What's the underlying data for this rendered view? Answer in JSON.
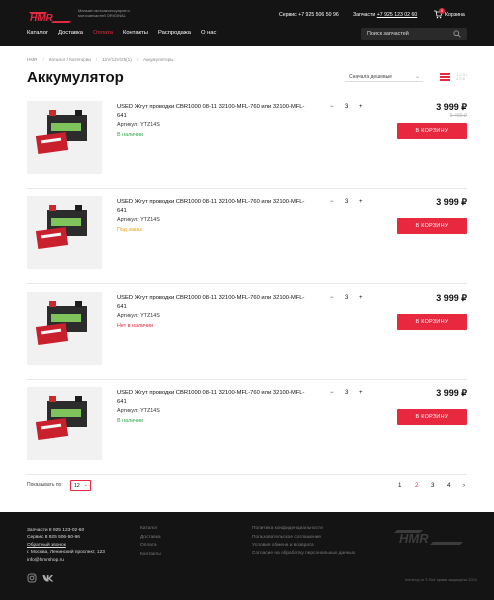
{
  "header": {
    "tagline": "Магазин мотоаксессуаров и мотозапчастей ORIGINAL",
    "service_phone": "Сервис +7 925 506 50 96",
    "parts_label": "Запчасти",
    "parts_phone": "+7 925 123 02 60",
    "cart_label": "Корзина",
    "cart_count": "0",
    "nav": [
      "Каталог",
      "Доставка",
      "Оплата",
      "Контакты",
      "Распродажа",
      "О нас"
    ],
    "search_placeholder": "Поиск запчастей"
  },
  "breadcrumbs": [
    "HMR",
    "Каталог / Категории",
    "12V/12V/25(1)",
    "Аккумуляторы"
  ],
  "page_title": "Аккумулятор",
  "sort_label": "Сначала дешевые",
  "view_grid_label": "1 2 3 / 4 5 6",
  "products": [
    {
      "title": "USED Жгут проводки CBR1000 08-11 32100-MFL-760 или 32100-MFL-641",
      "article": "Артикул: YTZ14S",
      "stock": "В наличии",
      "stock_color": "#2ba84a",
      "qty": "3",
      "price": "3 999 ₽",
      "old_price": "5 490 ₽",
      "buy": "В КОРЗИНУ"
    },
    {
      "title": "USED Жгут проводки CBR1000 08-11 32100-MFL-760 или 32100-MFL-641",
      "article": "Артикул: YTZ14S",
      "stock": "Под заказ",
      "stock_color": "#f0a020",
      "qty": "3",
      "price": "3 999 ₽",
      "old_price": "",
      "buy": "В КОРЗИНУ"
    },
    {
      "title": "USED Жгут проводки CBR1000 08-11 32100-MFL-760 или 32100-MFL-641",
      "article": "Артикул: YTZ14S",
      "stock": "Нет в наличии",
      "stock_color": "#e8283f",
      "qty": "3",
      "price": "3 999 ₽",
      "old_price": "",
      "buy": "В КОРЗИНУ"
    },
    {
      "title": "USED Жгут проводки CBR1000 08-11 32100-MFL-760 или 32100-MFL-641",
      "article": "Артикул: YTZ14S",
      "stock": "В наличии",
      "stock_color": "#2ba84a",
      "qty": "3",
      "price": "3 999 ₽",
      "old_price": "",
      "buy": "В КОРЗИНУ"
    }
  ],
  "show_by_label": "Показывать по:",
  "show_by_value": "12",
  "pagination": [
    "1",
    "2",
    "3",
    "4",
    "›"
  ],
  "current_page": "2",
  "footer": {
    "contacts": [
      "Запчасти 8 925 123-02-60",
      "Сервис 8 925 506-50-96",
      "Обратный звонок",
      "г. Москва, Ленинский проспект, 123",
      "info@hmrshop.ru"
    ],
    "links": [
      "Каталог",
      "Доставка",
      "Оплата",
      "Контакты"
    ],
    "legal": [
      "Политика конфиденциальности",
      "Пользовательское соглашение",
      "Условия обмена и возврата",
      "Согласие на обработку персональных данных"
    ],
    "copyright": "hmrshop.ru © Все права защищены 2024"
  },
  "colors": {
    "accent": "#e8283f",
    "dark": "#141414"
  }
}
